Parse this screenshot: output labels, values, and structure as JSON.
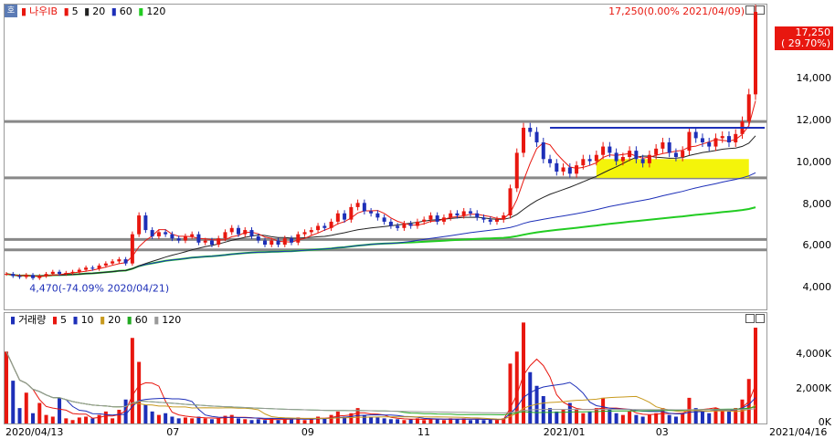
{
  "chart_data": [
    {
      "type": "candlestick",
      "legend": {
        "name": "나우IB",
        "ma": [
          {
            "label": "5",
            "color": "#e8170f"
          },
          {
            "label": "20",
            "color": "#222222"
          },
          {
            "label": "60",
            "color": "#1d2fb8"
          },
          {
            "label": "120",
            "color": "#22cc22"
          }
        ]
      },
      "ylim": [
        3000,
        17600
      ],
      "yticks": [
        "16,000",
        "14,000",
        "12,000",
        "10,000",
        "8,000",
        "6,000",
        "4,000"
      ],
      "ytick_values": [
        16000,
        14000,
        12000,
        10000,
        8000,
        6000,
        4000
      ],
      "xticks": [
        "2020/04/13",
        "07",
        "09",
        "11",
        "2021/01",
        "03",
        "2021/04/16"
      ],
      "annotations": {
        "high": "17,250(0.00% 2021/04/09)",
        "low": "4,470(-74.09% 2020/04/21)"
      },
      "current_price": {
        "value": "17,250",
        "change": "( 29.70%)"
      },
      "support_resistance": [
        12000,
        9300,
        6350,
        5850
      ],
      "close": [
        4700,
        4600,
        4550,
        4650,
        4500,
        4600,
        4700,
        4800,
        4700,
        4750,
        4800,
        4900,
        5000,
        4950,
        5100,
        5200,
        5300,
        5400,
        5200,
        6600,
        7500,
        6800,
        6500,
        6700,
        6600,
        6400,
        6300,
        6500,
        6600,
        6200,
        6300,
        6100,
        6400,
        6700,
        6900,
        6600,
        6800,
        6500,
        6300,
        6100,
        6300,
        6100,
        6400,
        6200,
        6600,
        6700,
        6800,
        7000,
        6900,
        7200,
        7600,
        7300,
        7900,
        8100,
        7700,
        7600,
        7400,
        7200,
        7000,
        6900,
        7100,
        7000,
        7200,
        7300,
        7500,
        7200,
        7400,
        7600,
        7500,
        7700,
        7600,
        7400,
        7300,
        7200,
        7300,
        7500,
        8800,
        10500,
        11700,
        11500,
        11000,
        10200,
        10000,
        9600,
        9800,
        9500,
        9900,
        10200,
        10100,
        10400,
        10800,
        10500,
        10100,
        10300,
        10600,
        10200,
        10000,
        10400,
        10700,
        11000,
        10500,
        10300,
        10600,
        11500,
        11200,
        11000,
        10800,
        11200,
        11300,
        11000,
        11400,
        12000,
        13300,
        17250
      ],
      "volume_ylim": [
        0,
        5600000
      ],
      "volume_ticks": [
        "4,000K",
        "2,000K",
        "0K"
      ],
      "volume_tick_values": [
        4000000,
        2000000,
        0
      ],
      "volume_legend": {
        "name": "거래량",
        "ma": [
          {
            "label": "5",
            "color": "#e8170f"
          },
          {
            "label": "10",
            "color": "#1d2fb8"
          },
          {
            "label": "20",
            "color": "#c89a1e"
          },
          {
            "label": "60",
            "color": "#22aa22"
          },
          {
            "label": "120",
            "color": "#999999"
          }
        ]
      },
      "volume": [
        4200000,
        2500000,
        900000,
        1800000,
        600000,
        1200000,
        500000,
        400000,
        1500000,
        300000,
        200000,
        350000,
        400000,
        300000,
        500000,
        700000,
        300000,
        800000,
        1400000,
        5000000,
        3600000,
        1100000,
        700000,
        500000,
        600000,
        400000,
        300000,
        350000,
        300000,
        400000,
        300000,
        250000,
        300000,
        450000,
        500000,
        300000,
        250000,
        200000,
        250000,
        200000,
        300000,
        200000,
        250000,
        300000,
        350000,
        200000,
        300000,
        400000,
        300000,
        500000,
        700000,
        400000,
        600000,
        900000,
        500000,
        400000,
        350000,
        300000,
        250000,
        250000,
        200000,
        250000,
        300000,
        200000,
        300000,
        250000,
        200000,
        300000,
        250000,
        300000,
        200000,
        250000,
        200000,
        250000,
        200000,
        300000,
        3500000,
        4200000,
        5900000,
        3000000,
        2200000,
        1600000,
        900000,
        700000,
        800000,
        1200000,
        800000,
        600000,
        700000,
        900000,
        1500000,
        800000,
        600000,
        500000,
        700000,
        500000,
        400000,
        500000,
        600000,
        900000,
        500000,
        400000,
        600000,
        1500000,
        900000,
        700000,
        600000,
        900000,
        800000,
        700000,
        900000,
        1400000,
        2600000,
        5600000
      ]
    }
  ]
}
